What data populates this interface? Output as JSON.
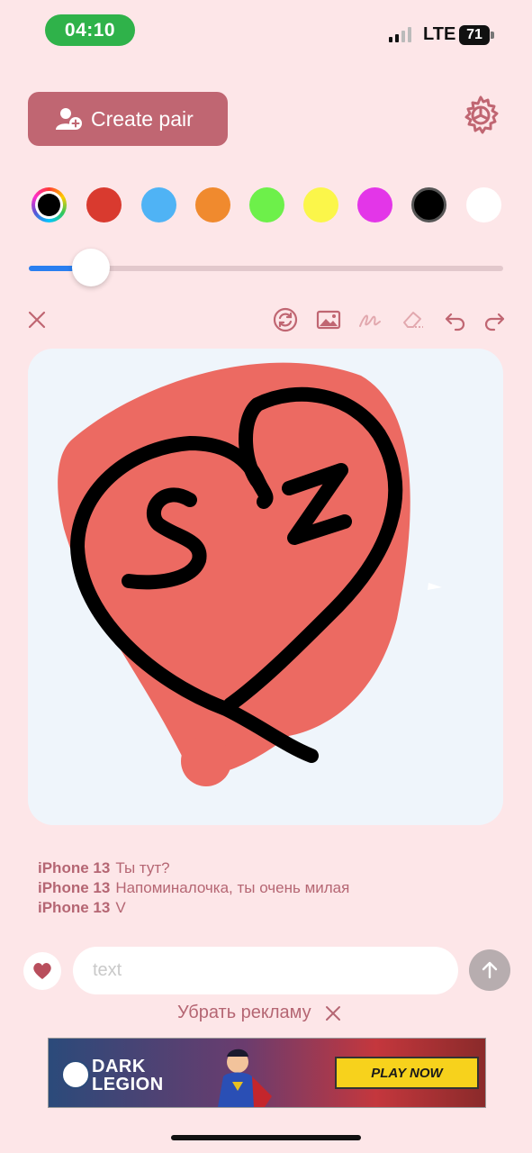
{
  "status_bar": {
    "time": "04:10",
    "network": "LTE",
    "battery": "71"
  },
  "header": {
    "create_pair_label": "Create pair",
    "settings_icon": "gear-icon"
  },
  "palette": {
    "colors": [
      "rainbow",
      "#d93a2f",
      "#4fb3f5",
      "#f08a2e",
      "#6df04a",
      "#fbf64a",
      "#e336e8",
      "#000000",
      "#ffffff"
    ],
    "selected": "#000000"
  },
  "brush": {
    "size_fraction": 0.13
  },
  "toolbar": {
    "icons": [
      "close-icon",
      "sync-icon",
      "image-icon",
      "draw-icon",
      "eraser-icon",
      "undo-icon",
      "redo-icon"
    ]
  },
  "messages": [
    {
      "sender": "iPhone 13",
      "text": "Ты тут?"
    },
    {
      "sender": "iPhone 13",
      "text": "Напоминалочка, ты очень милая"
    },
    {
      "sender": "iPhone 13",
      "text": "V"
    }
  ],
  "composer": {
    "placeholder": "text"
  },
  "ads": {
    "remove_label": "Убрать рекламу",
    "banner": {
      "brand_line1": "DARK",
      "brand_line2": "LEGION",
      "cta": "PLAY NOW"
    }
  },
  "colors": {
    "accent": "#c06672",
    "background": "#fde6e8",
    "canvas": "#eff5fb",
    "message_text": "#b56673"
  }
}
